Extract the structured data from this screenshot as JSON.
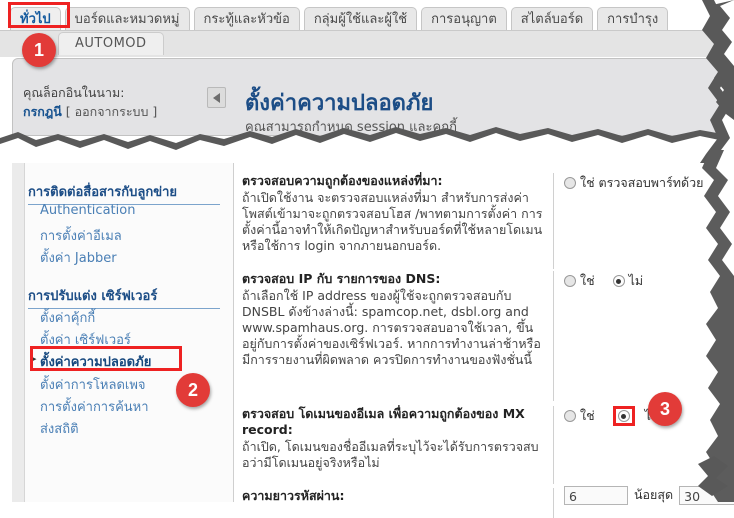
{
  "tabs": [
    {
      "label": "ทั่วไป",
      "active": true
    },
    {
      "label": "บอร์ดและหมวดหมู่",
      "active": false
    },
    {
      "label": "กระทู้และหัวข้อ",
      "active": false
    },
    {
      "label": "กลุ่มผู้ใช้และผู้ใช้",
      "active": false
    },
    {
      "label": "การอนุญาต",
      "active": false
    },
    {
      "label": "สไตล์บอร์ด",
      "active": false
    },
    {
      "label": "การบำรุง",
      "active": false
    }
  ],
  "subtab": {
    "label": "AUTOMOD"
  },
  "header": {
    "login_prefix": "คุณล็อกอินในนาม:",
    "username": "กรกฎนี",
    "logout": "[ ออกจากระบบ ]",
    "collapse_icon": "left-triangle-icon",
    "title": "ตั้งค่าความปลอดภัย",
    "subtitle": "คุณสามารถกำหนด session และคุกกี้"
  },
  "sidebar": {
    "groups": [
      {
        "title": "การติดต่อสื่อสารกับลูกข่าย",
        "items": [
          {
            "label": "Authentication",
            "selected": false
          },
          {
            "label": "การตั้งค่าอีเมล",
            "selected": false
          },
          {
            "label": "ตั้งค่า Jabber",
            "selected": false
          }
        ]
      },
      {
        "title": "การปรับแต่ง เซิร์ฟเวอร์",
        "items": [
          {
            "label": "ตั้งค่าคุ้กกี้",
            "selected": false
          },
          {
            "label": "ตั้งค่า เซิร์ฟเวอร์",
            "selected": false
          },
          {
            "label": "ตั้งค่าความปลอดภัย",
            "selected": true
          },
          {
            "label": "ตั้งค่าการโหลดเพจ",
            "selected": false
          },
          {
            "label": "การตั้งค่าการค้นหา",
            "selected": false
          },
          {
            "label": "ส่งสถิติ",
            "selected": false
          }
        ]
      }
    ]
  },
  "settings": [
    {
      "title": "ตรวจสอบความถูกต้องของแหล่งที่มา:",
      "desc": "ถ้าเปิดใช้งาน จะตรวจสอบแหล่งที่มา สำหรับการส่งค่าโพสต์เข้ามาจะถูกตรวจสอบโฮส /พาทตามการตั้งค่า การตั้งค่านี้อาจทำให้เกิดปัญหาสำหรับบอร์ดที่ใช้หลายโดเมน หรือใช้การ login จากภายนอกบอร์ด.",
      "control": "radio",
      "options": [
        {
          "label": "ใช่ ตรวจสอบพาร์ทด้วย",
          "checked": false
        }
      ]
    },
    {
      "title": "ตรวจสอบ IP กับ รายการของ DNS:",
      "desc": "ถ้าเลือกใช้ IP address ของผู้ใช้จะถูกตรวจสอบกับ DNSBL ดังข้างล่างนี้: spamcop.net, dsbl.org and www.spamhaus.org. การตรวจสอบอาจใช้เวลา, ขึ้นอยู่กับการตั้งค่าของเซิร์ฟเวอร์. หากการทำงานล่าช้าหรือมีการรายงานที่ผิดพลาด ควรปิดการทำงานของฟังชั่นนี้",
      "control": "radio",
      "options": [
        {
          "label": "ใช่",
          "checked": false
        },
        {
          "label": "ไม่",
          "checked": true
        }
      ]
    },
    {
      "title": "ตรวจสอบ โดเมนของอีเมล เพื่อความถูกต้องของ MX record:",
      "desc": "ถ้าเปิด, โดเมนของชื่ออีเมลที่ระบุไว้จะได้รับการตรวจสบอว่ามีโดเมนอยู่จริงหรือไม่",
      "control": "radio",
      "options": [
        {
          "label": "ใช่",
          "checked": false
        },
        {
          "label": "ไม่",
          "checked": true,
          "highlighted": true
        }
      ]
    },
    {
      "title": "ความยาวรหัสผ่าน:",
      "desc": "",
      "control": "range",
      "min_value": "6",
      "mid_label": "น้อยสุด",
      "max_value": "30"
    }
  ],
  "callouts": [
    {
      "number": "1"
    },
    {
      "number": "2"
    },
    {
      "number": "3"
    }
  ],
  "colors": {
    "accent_red": "#e23b38",
    "link_blue": "#4a7fb5",
    "title_blue": "#1c4d86"
  }
}
